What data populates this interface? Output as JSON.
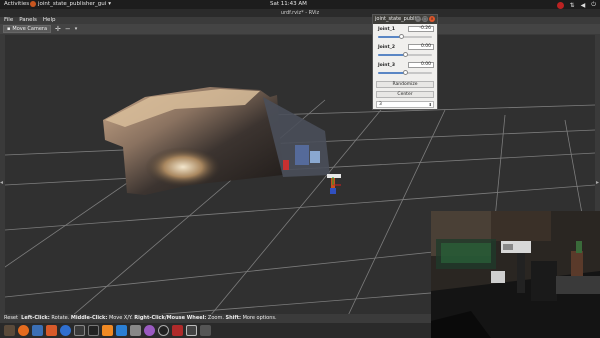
{
  "topbar": {
    "activities": "Activities",
    "app_name": "joint_state_publisher_gui",
    "app_arrow": "▾",
    "clock": "Sat 11:43 AM",
    "tray_icons": [
      "ubuntu-update-icon",
      "network-icon",
      "volume-icon",
      "power-icon"
    ]
  },
  "rviz": {
    "title": "urdf.rviz* - RViz",
    "menu": [
      "File",
      "Panels",
      "Help"
    ],
    "toolbar": {
      "move_camera": "Move Camera",
      "icons": [
        "move-icon",
        "minus-icon",
        "dropdown-icon"
      ]
    },
    "status": {
      "reset": "Reset",
      "left_click_key": "Left-Click:",
      "left_click_val": "Rotate.",
      "middle_click_key": "Middle-Click:",
      "middle_click_val": "Move X/Y.",
      "right_click_key": "Right-Click/Mouse Wheel:",
      "right_click_val": "Zoom.",
      "shift_key": "Shift:",
      "shift_val": "More options."
    }
  },
  "joint_window": {
    "title": "joint_state_publis...",
    "joints": [
      {
        "name": "Joint_1",
        "value": "-0.26",
        "fraction": 0.42
      },
      {
        "name": "Joint_2",
        "value": "0.00",
        "fraction": 0.5
      },
      {
        "name": "Joint_3",
        "value": "0.00",
        "fraction": 0.5
      }
    ],
    "randomize_label": "Randomize",
    "center_label": "Center",
    "select_value": "3"
  },
  "colors": {
    "viewport_bg": "#303030",
    "grid": "#8a8a8a",
    "accent_orange": "#e2572b",
    "slider_fill": "#5a86c4"
  },
  "dock": {
    "icons": [
      "files-icon",
      "firefox-icon",
      "mail-icon",
      "software-icon",
      "help-icon",
      "code-icon",
      "terminal-icon",
      "sublime-icon",
      "vscode-icon",
      "system-icon",
      "chrome-icon",
      "obs-icon",
      "screenshot-icon",
      "rviz-icon",
      "apps-grid-icon"
    ]
  }
}
